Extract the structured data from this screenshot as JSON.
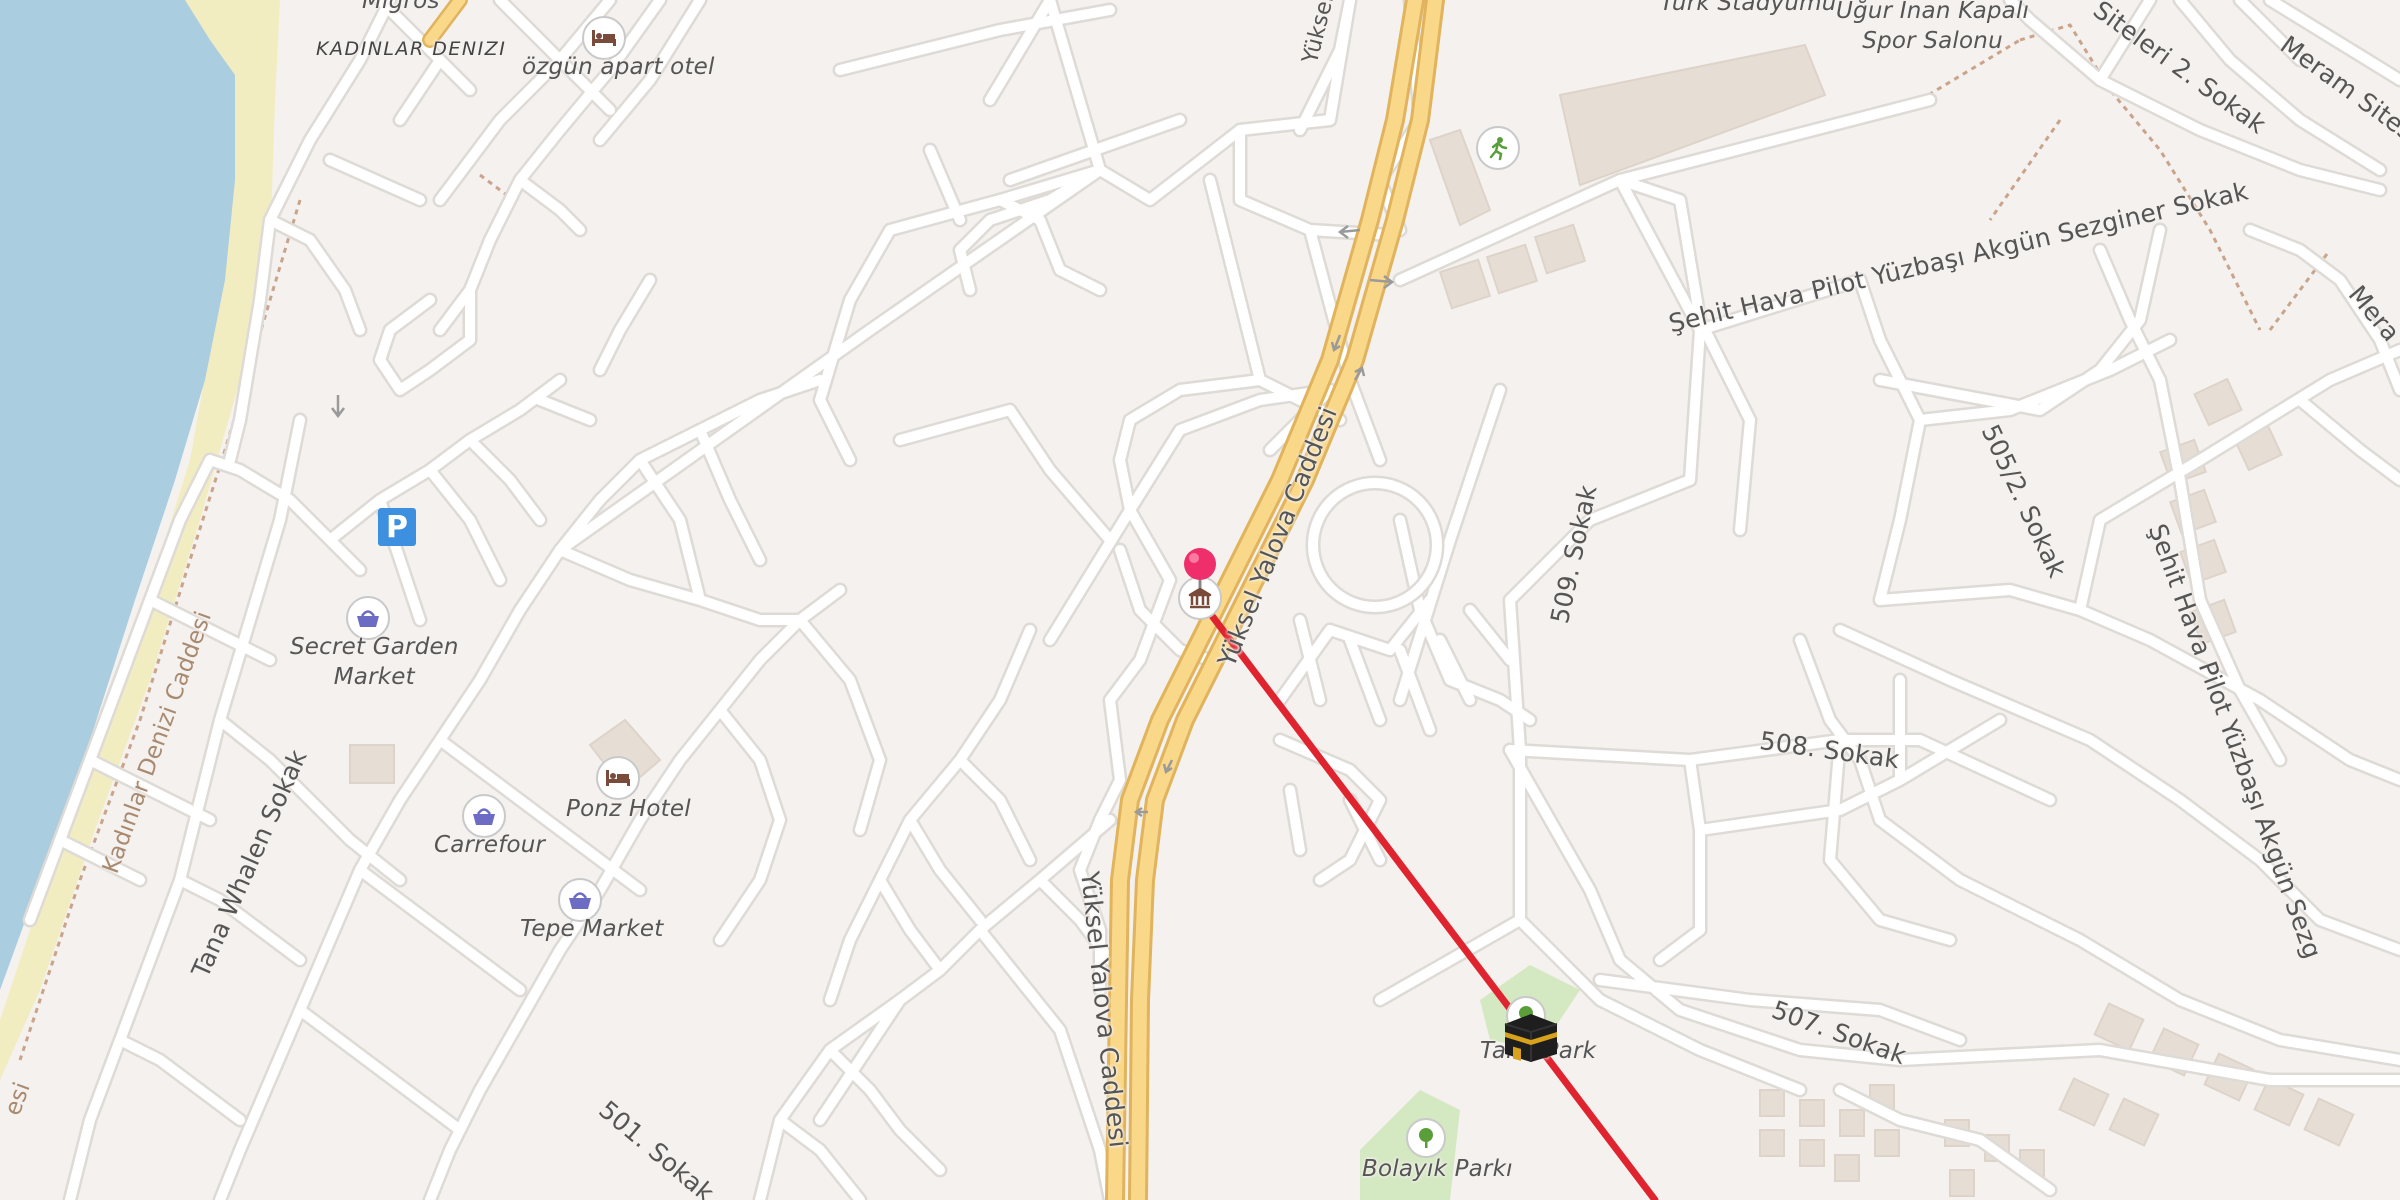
{
  "map": {
    "area_label": "KADINLAR DENIZI",
    "top_cut_label": "Migros",
    "streets": {
      "yuksel_yalova_upper": "Yüksel Yalova Cad",
      "yuksel_yalova_mid": "Yüksel Yalova Caddesi",
      "yuksel_yalova_lower": "Yüksel Yalova Caddesi",
      "sehit_hava_main": "Şehit Hava Pilot Yüzbaşı Akgün Sezginer Sokak",
      "sehit_hava_right": "Şehit Hava Pilot Yüzbaşı Akgün Sezg",
      "siteler_2": "Siteleri 2. Sokak",
      "meram": "Meram Sites",
      "meram_right": "Mera",
      "s509": "509. Sokak",
      "s505_2": "505/2. Sokak",
      "s508": "508. Sokak",
      "s507": "507. Sokak",
      "s501": "501. Sokak",
      "tana_whalen": "Tana Whalen Sokak",
      "kadinlar_denizi_cad": "Kadınlar Denizi Caddesi",
      "cad_bottom": "esi"
    },
    "pois": {
      "ozgun": "özgün apart otel",
      "secret_garden": "Secret Garden\nMarket",
      "ponz": "Ponz Hotel",
      "carrefour": "Carrefour",
      "tepe": "Tepe Market",
      "turk_stadyumu": "Türk Stadyumu",
      "ugur_inan": "Uğur İnan Kapalı\nSpor Salonu",
      "tahir_park": "Tahir Park",
      "bolayik": "Bolayık Parkı"
    },
    "parking_symbol": "P",
    "colors": {
      "land": "#f4f1ee",
      "sea": "#aacde0",
      "beach": "#f2edc0",
      "road": "#ffffff",
      "road_casing": "#dedad6",
      "main_road": "#fad88a",
      "main_road_casing": "#e0b35c",
      "route": "#e0242f",
      "pin": "#ee2f6b",
      "park": "#d4e8c2",
      "shop_icon": "#6c6cc5",
      "lodging_icon": "#7a4a3a"
    }
  }
}
